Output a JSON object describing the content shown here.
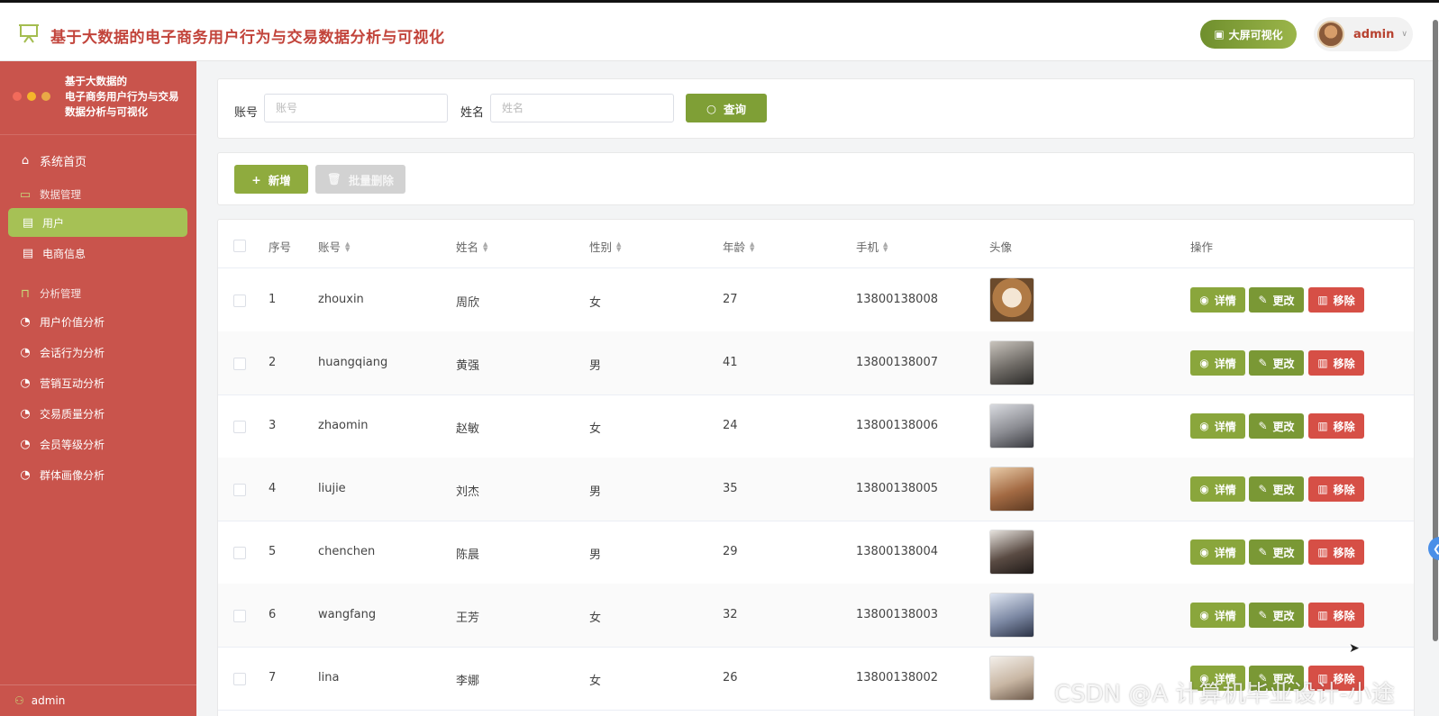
{
  "header": {
    "title": "基于大数据的电子商务用户行为与交易数据分析与可视化",
    "bigscreen_label": "大屏可视化",
    "username": "admin",
    "logo_icon": "presentation-board-icon",
    "accent_color": "#c2443b"
  },
  "sidebar": {
    "brand_lines": [
      "基于大数据的",
      "电子商务用户行为与交易",
      "数据分析与可视化"
    ],
    "home": "系统首页",
    "group_data": "数据管理",
    "items_data": [
      "用户",
      "电商信息"
    ],
    "group_analysis": "分析管理",
    "items_analysis": [
      "用户价值分析",
      "会话行为分析",
      "营销互动分析",
      "交易质量分析",
      "会员等级分析",
      "群体画像分析"
    ],
    "footer_user": "admin",
    "bg_color": "#c9544c",
    "active_color": "#a6c155"
  },
  "search": {
    "account_label": "账号",
    "account_placeholder": "账号",
    "name_label": "姓名",
    "name_placeholder": "姓名",
    "query_label": "查询"
  },
  "actions": {
    "add_label": "新增",
    "batch_delete_label": "批量删除"
  },
  "table": {
    "columns": [
      "序号",
      "账号",
      "姓名",
      "性别",
      "年龄",
      "手机",
      "头像",
      "操作"
    ],
    "op_labels": {
      "detail": "详情",
      "edit": "更改",
      "delete": "移除"
    },
    "rows": [
      {
        "index": "1",
        "account": "zhouxin",
        "name": "周欣",
        "gender": "女",
        "age": "27",
        "phone": "13800138008"
      },
      {
        "index": "2",
        "account": "huangqiang",
        "name": "黄强",
        "gender": "男",
        "age": "41",
        "phone": "13800138007"
      },
      {
        "index": "3",
        "account": "zhaomin",
        "name": "赵敏",
        "gender": "女",
        "age": "24",
        "phone": "13800138006"
      },
      {
        "index": "4",
        "account": "liujie",
        "name": "刘杰",
        "gender": "男",
        "age": "35",
        "phone": "13800138005"
      },
      {
        "index": "5",
        "account": "chenchen",
        "name": "陈晨",
        "gender": "男",
        "age": "29",
        "phone": "13800138004"
      },
      {
        "index": "6",
        "account": "wangfang",
        "name": "王芳",
        "gender": "女",
        "age": "32",
        "phone": "13800138003"
      },
      {
        "index": "7",
        "account": "lina",
        "name": "李娜",
        "gender": "女",
        "age": "26",
        "phone": "13800138002"
      }
    ]
  },
  "watermark": "CSDN @A 计算机毕业设计-小途"
}
